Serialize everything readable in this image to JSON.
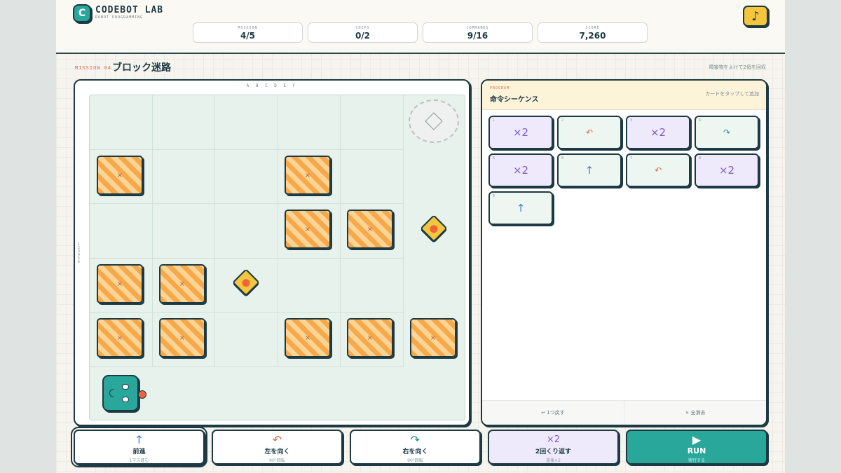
{
  "brand": {
    "name": "CODEBOT LAB",
    "tagline": "ROBOT PROGRAMMING",
    "logo_letter": "C"
  },
  "stats": [
    {
      "label": "MISSION",
      "value": "4/5"
    },
    {
      "label": "CHIPS",
      "value": "0/2"
    },
    {
      "label": "COMMANDS",
      "value": "9/16"
    },
    {
      "label": "SCORE",
      "value": "7,260"
    }
  ],
  "music_icon": "♪",
  "mission": {
    "tag": "MISSION 04",
    "title": "ブロック迷路",
    "hint": "障害物をよけて2個を回収"
  },
  "board": {
    "col_labels": "A B C D E F",
    "row_labels": "1 2 3 4 5 6",
    "block_mark": "×",
    "colors": {
      "grid_bg": "#e7f2ec",
      "block": "#f6a94a",
      "robot": "#2aa79b",
      "chip": "#f4c63d"
    }
  },
  "program": {
    "tag": "PROGRAM",
    "title": "命令シーケンス",
    "hint": "カードをタップして追加",
    "cards": [
      {
        "num": "1",
        "type": "rep",
        "icon": "×2"
      },
      {
        "num": "2",
        "type": "left",
        "icon": "↶"
      },
      {
        "num": "3",
        "type": "rep",
        "icon": "×2"
      },
      {
        "num": "4",
        "type": "right",
        "icon": "↷"
      },
      {
        "num": "5",
        "type": "rep",
        "icon": "×2"
      },
      {
        "num": "6",
        "type": "fwd",
        "icon": "↑"
      },
      {
        "num": "7",
        "type": "left",
        "icon": "↶"
      },
      {
        "num": "8",
        "type": "rep",
        "icon": "×2"
      },
      {
        "num": "9",
        "type": "fwd",
        "icon": "↑"
      }
    ],
    "undo_label": "↩ 1つ戻す",
    "clear_label": "× 全消去"
  },
  "controls": {
    "forward": {
      "icon": "↑",
      "label": "前進",
      "sub": "1マス進む"
    },
    "left": {
      "icon": "↶",
      "label": "左を向く",
      "sub": "90°回転"
    },
    "right": {
      "icon": "↷",
      "label": "右を向く",
      "sub": "90°回転"
    },
    "repeat": {
      "icon": "×2",
      "label": "2回くり返す",
      "sub": "直後×2"
    },
    "run": {
      "icon": "▶",
      "label": "RUN",
      "sub": "実行する"
    }
  }
}
